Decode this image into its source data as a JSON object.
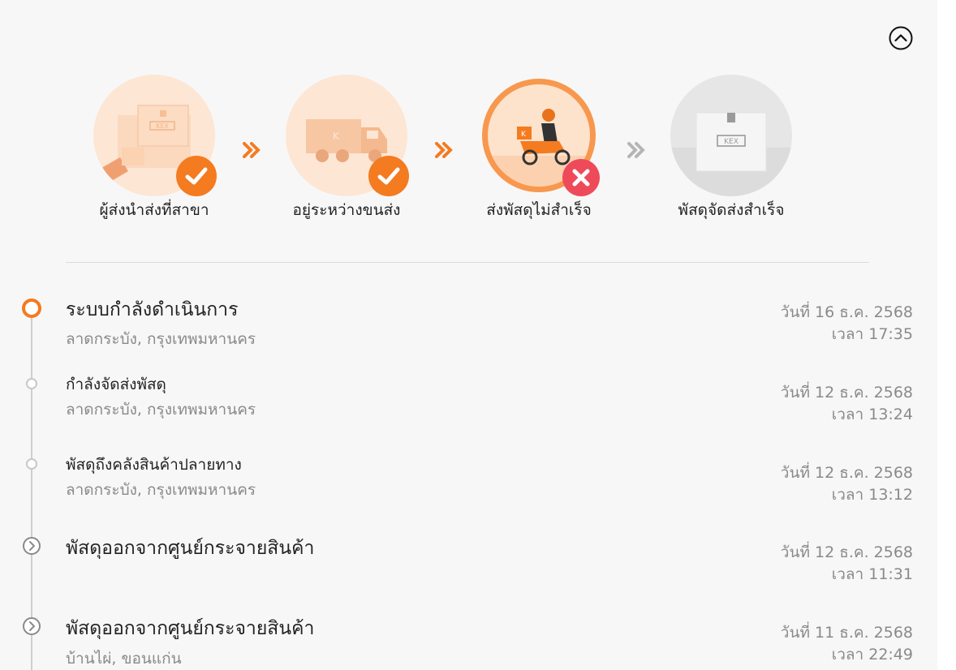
{
  "colors": {
    "accent": "#f47b20",
    "fail": "#ef4a5a",
    "light_orange": "#fde2cc",
    "inactive": "#d8d8d8",
    "text": "#222222",
    "muted": "#8a8a8a"
  },
  "collapse_icon": "chevron-up-icon",
  "steps": [
    {
      "label": "ผู้ส่งนำส่งที่สาขา",
      "status": "done",
      "icon": "boxes-drop-off-icon"
    },
    {
      "label": "อยู่ระหว่างขนส่ง",
      "status": "done",
      "icon": "truck-icon"
    },
    {
      "label": "ส่งพัสดุไม่สำเร็จ",
      "status": "failed",
      "icon": "courier-scooter-icon"
    },
    {
      "label": "พัสดุจัดส่งสำเร็จ",
      "status": "pending",
      "icon": "kex-box-icon",
      "box_text": "KEX"
    }
  ],
  "events": [
    {
      "title": "ระบบกำลังดำเนินการ",
      "location": "ลาดกระบัง, กรุงเทพมหานคร",
      "date": "วันที่ 16 ธ.ค. 2568",
      "time": "เวลา 17:35"
    },
    {
      "title": "กำลังจัดส่งพัสดุ",
      "location": "ลาดกระบัง, กรุงเทพมหานคร",
      "date": "วันที่ 12 ธ.ค. 2568",
      "time": "เวลา 13:24"
    },
    {
      "title": "พัสดุถึงคลังสินค้าปลายทาง",
      "location": "ลาดกระบัง, กรุงเทพมหานคร",
      "date": "วันที่ 12 ธ.ค. 2568",
      "time": "เวลา 13:12"
    },
    {
      "title": "พัสดุออกจากศูนย์กระจายสินค้า",
      "location": "",
      "date": "วันที่ 12 ธ.ค. 2568",
      "time": "เวลา 11:31"
    },
    {
      "title": "พัสดุออกจากศูนย์กระจายสินค้า",
      "location": "บ้านไผ่, ขอนแก่น",
      "date": "วันที่ 11 ธ.ค. 2568",
      "time": "เวลา 22:49"
    }
  ]
}
